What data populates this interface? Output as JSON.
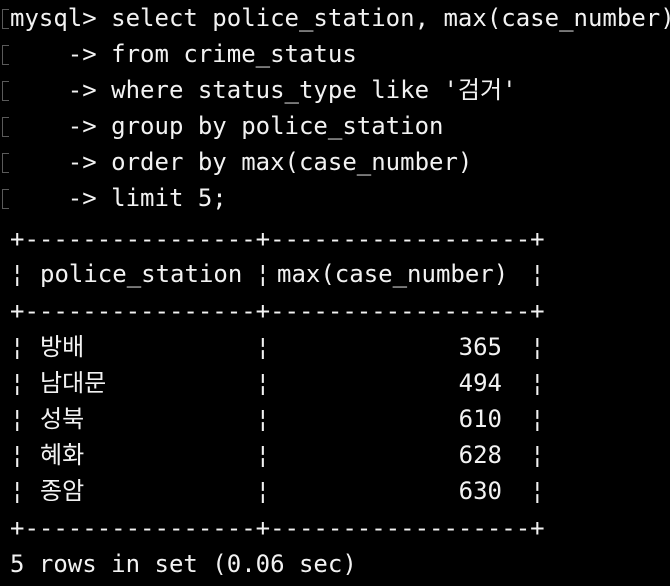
{
  "window": {
    "background": "#000000",
    "text_color": "#f2f2f2"
  },
  "query": {
    "lines": [
      "mysql> select police_station, max(case_number)",
      "    -> from crime_status",
      "    -> where status_type like '검거'",
      "    -> group by police_station",
      "    -> order by max(case_number)",
      "    -> limit 5;"
    ]
  },
  "result_table": {
    "border_line": "+----------------+------------------+",
    "columns": [
      "police_station",
      "max(case_number)"
    ],
    "rows": [
      {
        "police_station": "방배",
        "max_case_number": "365"
      },
      {
        "police_station": "남대문",
        "max_case_number": "494"
      },
      {
        "police_station": "성북",
        "max_case_number": "610"
      },
      {
        "police_station": "혜화",
        "max_case_number": "628"
      },
      {
        "police_station": "종암",
        "max_case_number": "630"
      }
    ]
  },
  "status": {
    "summary": "5 rows in set (0.06 sec)"
  }
}
